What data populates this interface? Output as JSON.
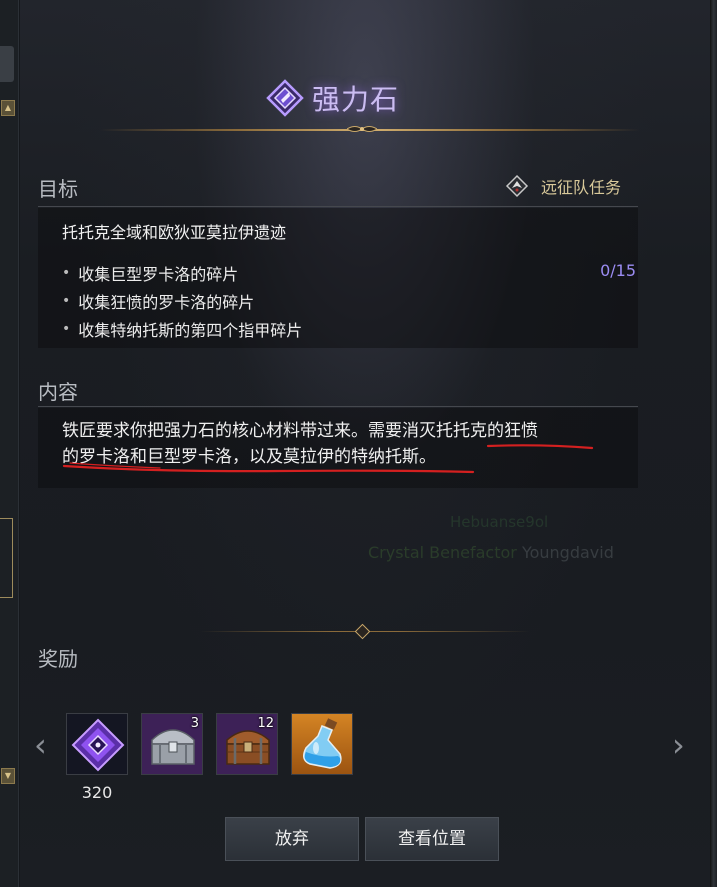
{
  "header": {
    "title": "强力石",
    "icon": "quest-gem-icon"
  },
  "target": {
    "heading": "目标",
    "quest_type": "远征队任务",
    "quest_type_icon": "expedition-icon",
    "region": "托托克全域和欧狄亚莫拉伊遗迹",
    "objectives": [
      {
        "text": "收集巨型罗卡洛的碎片",
        "progress": "0/15"
      },
      {
        "text": "收集狂愤的罗卡洛的碎片"
      },
      {
        "text": "收集特纳托斯的第四个指甲碎片"
      }
    ]
  },
  "content": {
    "heading": "内容",
    "line1": "铁匠要求你把强力石的核心材料带过来。需要消灭托托克的狂愤",
    "line2": "的罗卡洛和巨型罗卡洛，以及莫拉伊的特纳托斯。"
  },
  "watermark": {
    "line1": "Hebuanse9ol",
    "line2a": "Crystal Benefactor",
    "line2b": "Youngdavid"
  },
  "rewards": {
    "heading": "奖励",
    "items": [
      {
        "icon": "power-stone-icon",
        "quantity": "320"
      },
      {
        "icon": "silver-chest-icon",
        "count": "3"
      },
      {
        "icon": "wooden-chest-icon",
        "count": "12"
      },
      {
        "icon": "potion-bottle-icon"
      }
    ]
  },
  "buttons": {
    "abandon": "放弃",
    "view_location": "查看位置"
  },
  "colors": {
    "title": "#cbbcf2",
    "progress": "#9b8cf2",
    "quest_type": "#d9c99a",
    "accent_gold": "#c9a86a"
  }
}
